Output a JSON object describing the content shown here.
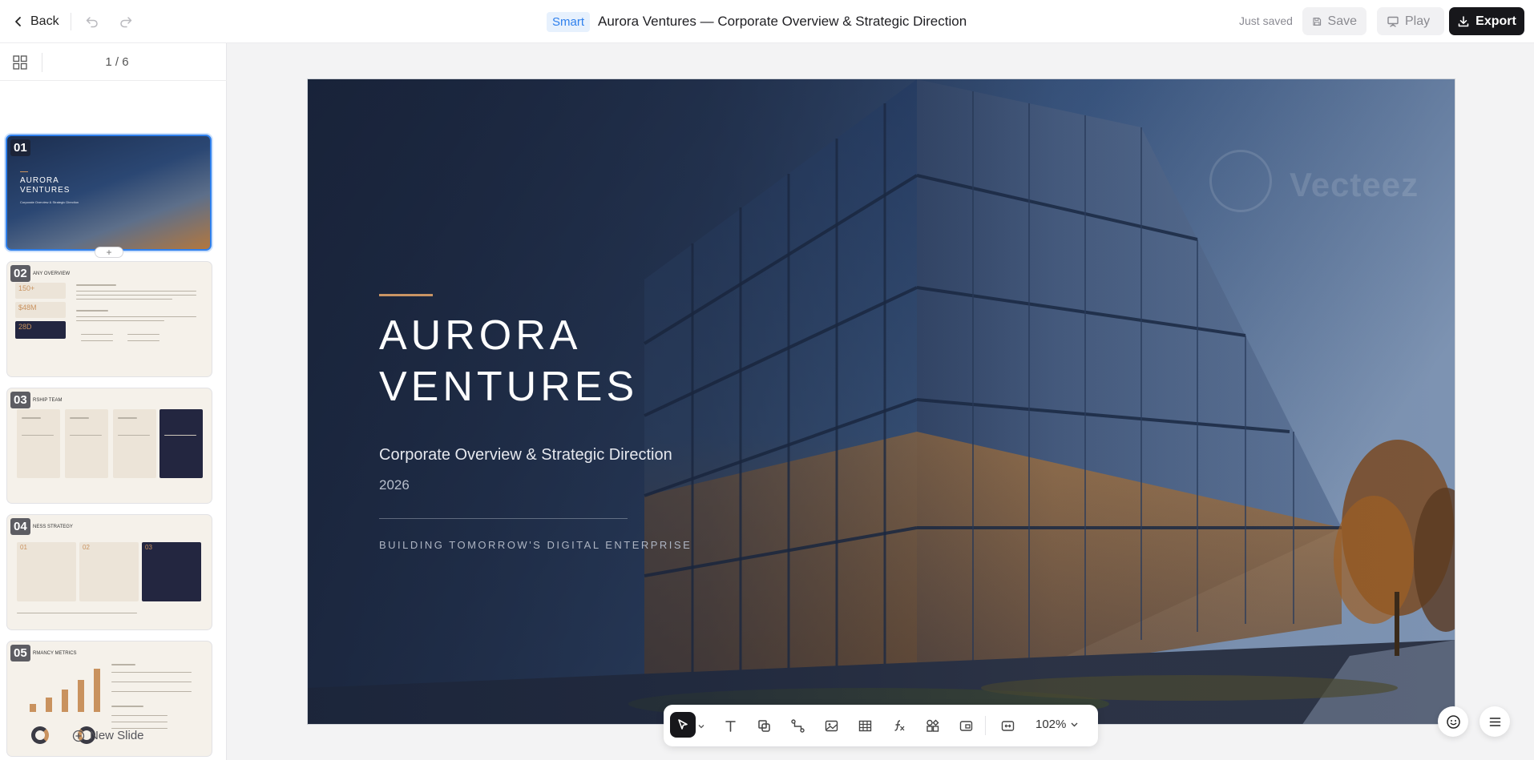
{
  "topbar": {
    "back_label": "Back",
    "smart_badge": "Smart",
    "doc_title": "Aurora Ventures — Corporate Overview & Strategic Direction",
    "save_status": "Just saved",
    "save_label": "Save",
    "play_label": "Play",
    "export_label": "Export"
  },
  "sidebar": {
    "page_indicator": "1 / 6",
    "thumbnails": [
      {
        "number": "01",
        "title_line1": "AURORA",
        "title_line2": "VENTURES",
        "subtitle": "Corporate Overview & Strategic Direction"
      },
      {
        "number": "02",
        "heading": "ANY OVERVIEW",
        "stat1": "150+",
        "stat2": "$48M",
        "stat3": "28D"
      },
      {
        "number": "03",
        "heading": "RSHIP TEAM"
      },
      {
        "number": "04",
        "heading": "NESS STRATEGY",
        "col1": "01",
        "col2": "02",
        "col3": "03"
      },
      {
        "number": "05",
        "heading": "RMANCY METRICS"
      }
    ],
    "new_slide_label": "New Slide"
  },
  "slide": {
    "title_line1": "AURORA",
    "title_line2": "VENTURES",
    "subtitle": "Corporate Overview & Strategic Direction",
    "year": "2026",
    "tagline": "BUILDING TOMORROW'S DIGITAL ENTERPRISE",
    "watermark": "Vecteez",
    "accent_color": "#c99464"
  },
  "toolbar": {
    "tools": [
      "select-icon",
      "text-icon",
      "shapes-icon",
      "connector-icon",
      "image-icon",
      "table-icon",
      "formula-icon",
      "components-icon",
      "media-icon",
      "fit-icon"
    ],
    "zoom": "102%"
  }
}
